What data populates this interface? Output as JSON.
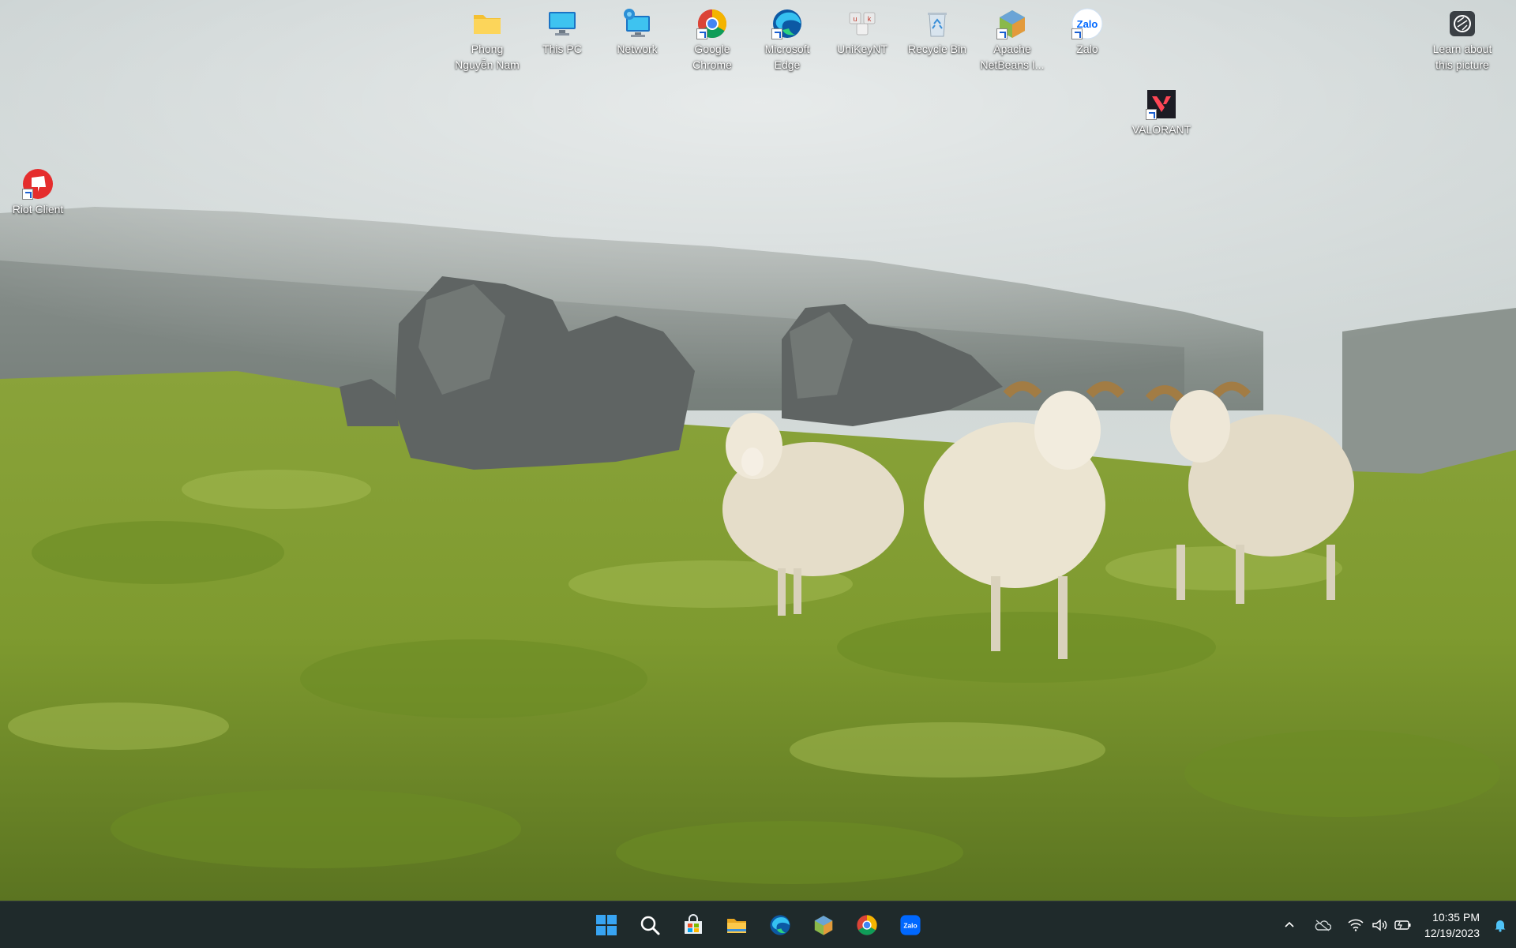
{
  "desktop": {
    "icons": [
      {
        "id": "folder",
        "label": "Phong\nNguyễn Nam",
        "icon": "folder-icon"
      },
      {
        "id": "thispc",
        "label": "This PC",
        "icon": "this-pc-icon"
      },
      {
        "id": "network",
        "label": "Network",
        "icon": "network-icon"
      },
      {
        "id": "chrome",
        "label": "Google\nChrome",
        "icon": "chrome-icon"
      },
      {
        "id": "edge",
        "label": "Microsoft\nEdge",
        "icon": "edge-icon"
      },
      {
        "id": "unikey",
        "label": "UniKeyNT",
        "icon": "unikey-icon"
      },
      {
        "id": "recycle",
        "label": "Recycle Bin",
        "icon": "recycle-bin-icon"
      },
      {
        "id": "netbeans",
        "label": "Apache\nNetBeans I...",
        "icon": "netbeans-icon"
      },
      {
        "id": "zalo",
        "label": "Zalo",
        "icon": "zalo-icon"
      },
      {
        "id": "valorant",
        "label": "VALORANT",
        "icon": "valorant-icon"
      },
      {
        "id": "riot",
        "label": "Riot Client",
        "icon": "riot-client-icon"
      },
      {
        "id": "learn",
        "label": "Learn about\nthis picture",
        "icon": "camera-icon"
      }
    ],
    "wallpaper": "sheep-on-mossy-hillside",
    "zalo_text": "Zalo"
  },
  "taskbar": {
    "apps": [
      {
        "name": "start",
        "icon": "windows-start-icon"
      },
      {
        "name": "search",
        "icon": "search-icon"
      },
      {
        "name": "store",
        "icon": "microsoft-store-icon"
      },
      {
        "name": "explorer",
        "icon": "file-explorer-icon"
      },
      {
        "name": "edge",
        "icon": "edge-icon"
      },
      {
        "name": "netbeans",
        "icon": "netbeans-icon"
      },
      {
        "name": "chrome",
        "icon": "chrome-icon"
      },
      {
        "name": "zalo",
        "icon": "zalo-icon"
      }
    ],
    "tray": {
      "icons": [
        "chevron-up-icon",
        "onedrive-icon",
        "wifi-icon",
        "volume-icon",
        "battery-icon"
      ],
      "time": "10:35 PM",
      "date": "12/19/2023"
    }
  },
  "colors": {
    "taskbar_bg": "#1f2a2b",
    "accent": "#0078d4"
  }
}
